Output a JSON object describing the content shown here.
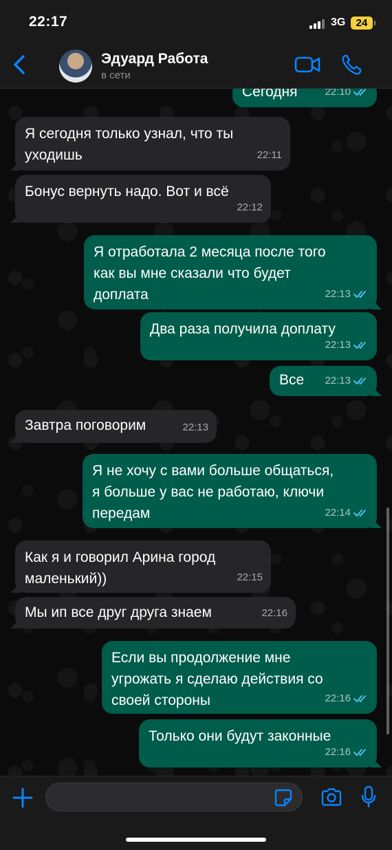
{
  "status_bar": {
    "time": "22:17",
    "network": "3G",
    "battery": "24"
  },
  "header": {
    "contact_name": "Эдуард Работа",
    "contact_status": "в сети"
  },
  "messages": [
    {
      "dir": "out",
      "text": "Сегодня",
      "time": "22:10",
      "read": true
    },
    {
      "dir": "in",
      "text": "Я сегодня только узнал, что ты\nуходишь",
      "time": "22:11"
    },
    {
      "dir": "in",
      "text": "Бонус вернуть надо. Вот и всё",
      "time": "22:12"
    },
    {
      "dir": "out",
      "text": "Я отработала 2 месяца после того\nкак вы мне сказали что будет\nдоплата",
      "time": "22:13",
      "read": true
    },
    {
      "dir": "out",
      "text": "Два раза получила доплату",
      "time": "22:13",
      "read": true
    },
    {
      "dir": "out",
      "text": "Все",
      "time": "22:13",
      "read": true
    },
    {
      "dir": "in",
      "text": "Завтра поговорим",
      "time": "22:13"
    },
    {
      "dir": "out",
      "text": "Я не хочу с вами больше общаться,\nя больше у вас не работаю, ключи\nпередам",
      "time": "22:14",
      "read": true
    },
    {
      "dir": "in",
      "text": "Как я и говорил Арина город\nмаленький))",
      "time": "22:15"
    },
    {
      "dir": "in",
      "text": "Мы ип все друг друга знаем",
      "time": "22:16"
    },
    {
      "dir": "out",
      "text": "Если вы продолжение мне\nугрожать я сделаю действия со\nсвоей стороны",
      "time": "22:16",
      "read": true
    },
    {
      "dir": "out",
      "text": "Только они будут законные",
      "time": "22:16",
      "read": true
    }
  ],
  "composer": {
    "value": "",
    "placeholder": ""
  },
  "icons": {
    "back": "chevron-left-icon",
    "video_call": "video-camera-icon",
    "voice_call": "phone-icon",
    "attach": "plus-icon",
    "sticker": "sticker-icon",
    "camera": "camera-icon",
    "microphone": "microphone-icon",
    "read_receipt": "double-check-icon"
  },
  "colors": {
    "accent": "#0a84ff",
    "outgoing_bubble": "#005c4b",
    "incoming_bubble": "#262628",
    "read_tick": "#53bdeb"
  }
}
